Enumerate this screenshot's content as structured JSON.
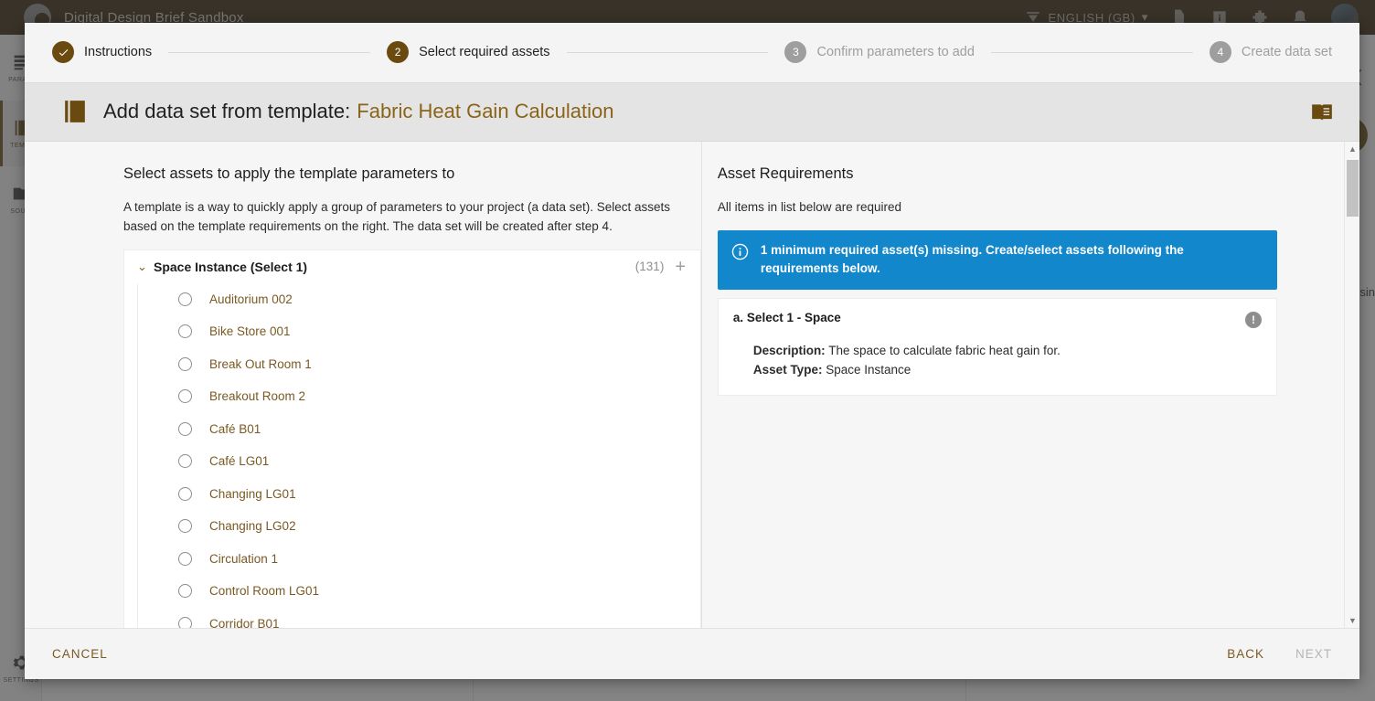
{
  "app": {
    "title": "Digital Design Brief Sandbox",
    "language": "ENGLISH (GB)",
    "language_caret": "▾",
    "topbar_icons": [
      "translate-icon",
      "document-icon",
      "info-icon",
      "puzzle-icon",
      "notification-icon"
    ],
    "right_edge_text": "usin",
    "fab_label": "+",
    "chevron": "❮"
  },
  "sidebar": {
    "items": [
      {
        "label": "PARAM",
        "icon": "parameters-icon",
        "active": false
      },
      {
        "label": "TEMPL",
        "icon": "templates-icon",
        "active": true
      },
      {
        "label": "SOUR",
        "icon": "sources-icon",
        "active": false
      }
    ],
    "bottom": {
      "label": "SETTINGS",
      "icon": "gear-icon"
    }
  },
  "stepper": {
    "steps": [
      {
        "num": "✓",
        "label": "Instructions",
        "state": "done"
      },
      {
        "num": "2",
        "label": "Select required assets",
        "state": "current"
      },
      {
        "num": "3",
        "label": "Confirm parameters to add",
        "state": "upcoming"
      },
      {
        "num": "4",
        "label": "Create data set",
        "state": "upcoming"
      }
    ]
  },
  "modal": {
    "title_prefix": "Add data set from template:",
    "title_accent": "Fabric Heat Gain Calculation",
    "title_icon": "template-document-icon",
    "help_icon": "book-icon"
  },
  "left": {
    "heading": "Select assets to apply the template parameters to",
    "description": "A template is a way to quickly apply a group of parameters to your project (a data set). Select assets based on the template requirements on the right. The data set will be created after step 4.",
    "group": {
      "chevron": "⌄",
      "label": "Space Instance (Select 1)",
      "count": "(131)",
      "add": "+"
    },
    "options": [
      "Auditorium 002",
      "Bike Store 001",
      "Break Out Room 1",
      "Breakout Room 2",
      "Café B01",
      "Café LG01",
      "Changing LG01",
      "Changing LG02",
      "Circulation 1",
      "Control Room LG01",
      "Corridor B01"
    ]
  },
  "right": {
    "heading": "Asset Requirements",
    "subtext": "All items in list below are required",
    "banner": {
      "icon": "info-circle-icon",
      "text": "1 minimum required asset(s) missing. Create/select assets following the requirements below."
    },
    "requirement": {
      "title": "a. Select 1 - Space",
      "description_label": "Description:",
      "description_value": "The space to calculate fabric heat gain for.",
      "asset_type_label": "Asset Type:",
      "asset_type_value": "Space Instance",
      "badge": "!"
    }
  },
  "footer": {
    "cancel": "CANCEL",
    "back": "BACK",
    "next": "NEXT"
  },
  "colors": {
    "brand_brown": "#6b4a10",
    "accent_text": "#8a6418",
    "info_blue": "#1287cc",
    "topbar": "#33240a"
  }
}
